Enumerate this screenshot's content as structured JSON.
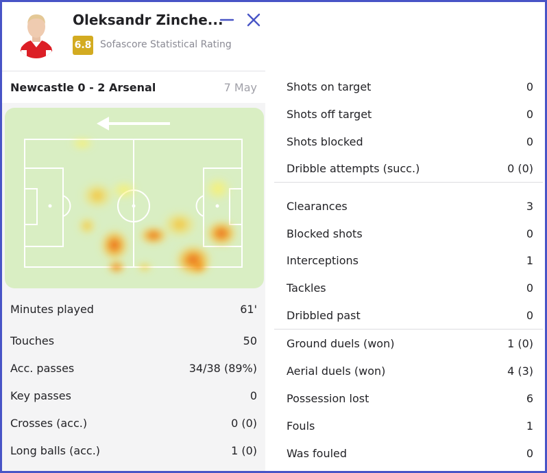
{
  "player": {
    "name": "Oleksandr Zinche...",
    "rating": "6.8",
    "rating_label": "Sofascore Statistical Rating"
  },
  "match": {
    "title": "Newcastle 0 - 2 Arsenal",
    "date": "7 May"
  },
  "icons": {
    "minimize": "minimize-icon",
    "close": "close-icon",
    "direction": "arrow-left-icon"
  },
  "colors": {
    "accent": "#4854c6",
    "rating": "#d3ab21",
    "pitch": "#d9eec3"
  },
  "left_stats": [
    {
      "label": "Minutes played",
      "value": "61'"
    },
    {
      "label": "Touches",
      "value": "50"
    },
    {
      "label": "Acc. passes",
      "value": "34/38 (89%)"
    },
    {
      "label": "Key passes",
      "value": "0"
    },
    {
      "label": "Crosses (acc.)",
      "value": "0 (0)"
    },
    {
      "label": "Long balls (acc.)",
      "value": "1 (0)"
    }
  ],
  "right_stats": [
    {
      "label": "Shots on target",
      "value": "0"
    },
    {
      "label": "Shots off target",
      "value": "0"
    },
    {
      "label": "Shots blocked",
      "value": "0"
    },
    {
      "label": "Dribble attempts (succ.)",
      "value": "0 (0)"
    },
    {
      "label": "Clearances",
      "value": "3"
    },
    {
      "label": "Blocked shots",
      "value": "0"
    },
    {
      "label": "Interceptions",
      "value": "1"
    },
    {
      "label": "Tackles",
      "value": "0"
    },
    {
      "label": "Dribbled past",
      "value": "0"
    },
    {
      "label": "Ground duels (won)",
      "value": "1 (0)"
    },
    {
      "label": "Aerial duels (won)",
      "value": "4 (3)"
    },
    {
      "label": "Possession lost",
      "value": "6"
    },
    {
      "label": "Fouls",
      "value": "1"
    },
    {
      "label": "Was fouled",
      "value": "0"
    }
  ]
}
